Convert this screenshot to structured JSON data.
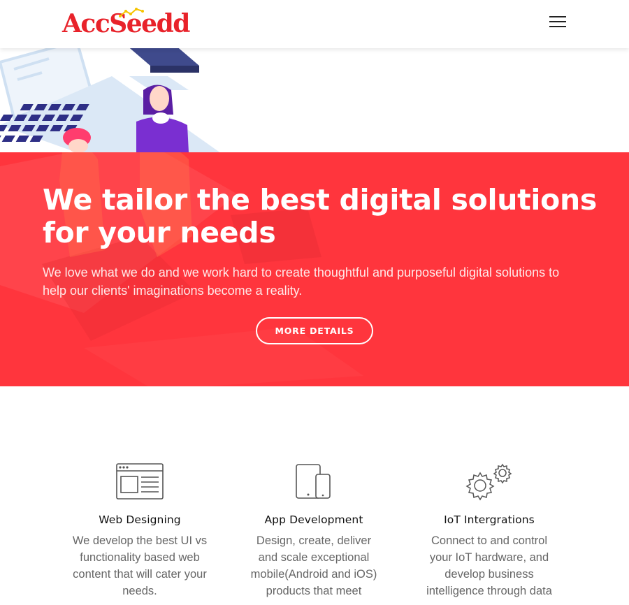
{
  "brand": {
    "logo_text": "AccSeedd",
    "accent": "#ff353d"
  },
  "header": {
    "menu_icon": "hamburger-icon"
  },
  "hero": {
    "title": "We tailor the best digital solutions for your needs",
    "subtitle": "We love what we do and we work hard to create thoughtful and purposeful digital solutions to help our clients' imaginations become a reality.",
    "cta_label": "MORE DETAILS"
  },
  "services": [
    {
      "icon": "browser-layout-icon",
      "title": "Web Designing",
      "description": "We develop the best UI vs functionality based web content that will cater your needs."
    },
    {
      "icon": "tablet-phone-icon",
      "title": "App Development",
      "description": "Design, create, deliver and scale exceptional mobile(Android and iOS) products that meet"
    },
    {
      "icon": "gears-icon",
      "title": "IoT Intergrations",
      "description": "Connect to and control your IoT hardware, and develop business intelligence through data"
    }
  ]
}
